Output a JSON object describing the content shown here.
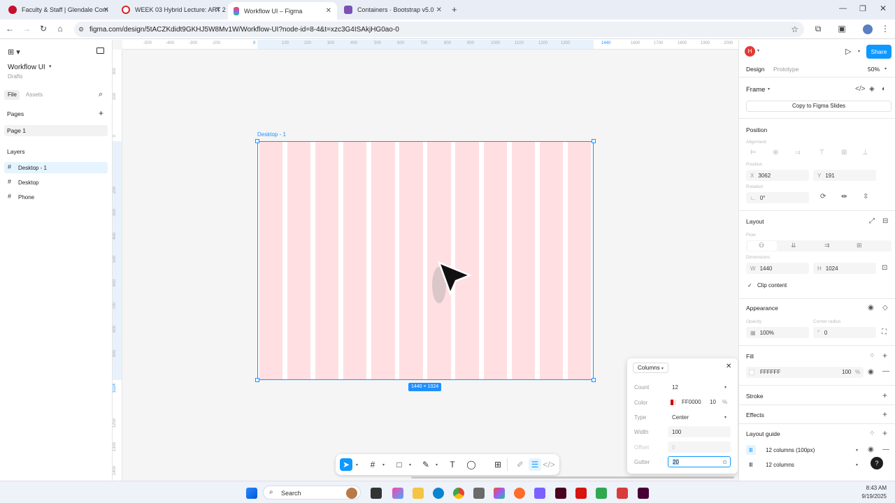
{
  "browser": {
    "tabs": [
      {
        "title": "Faculty & Staff | Glendale Com",
        "color": "#c8102e"
      },
      {
        "title": "WEEK 03 Hybrid Lecture: ART 2",
        "color": "#d22"
      },
      {
        "title": "Workflow UI – Figma",
        "color": "#a259ff"
      },
      {
        "title": "Containers · Bootstrap v5.0",
        "color": "#7952b3"
      }
    ],
    "url": "figma.com/design/5tACZKdidt9GKHJ5W8Mv1W/Workflow-UI?node-id=8-4&t=xzc3G4ISAkjHG0ao-0"
  },
  "left": {
    "file_name": "Workflow UI",
    "file_sub": "Drafts",
    "tab_file": "File",
    "tab_assets": "Assets",
    "pages_title": "Pages",
    "pages": [
      "Page 1"
    ],
    "layers_title": "Layers",
    "layers": [
      "Desktop - 1",
      "Desktop",
      "Phone"
    ]
  },
  "canvas": {
    "frame_label": "Desktop - 1",
    "frame_size": "1440 × 1024",
    "ruler_top": [
      "-500",
      "-400",
      "-300",
      "-200",
      "0",
      "100",
      "200",
      "300",
      "400",
      "500",
      "600",
      "700",
      "800",
      "900",
      "1000",
      "1100",
      "1200",
      "1300",
      "1440",
      "1600",
      "1700",
      "1800",
      "1900",
      "2000"
    ],
    "ruler_left": [
      "300",
      "200",
      "0",
      "200",
      "300",
      "400",
      "500",
      "600",
      "700",
      "800",
      "900",
      "1024",
      "1200",
      "1300",
      "1400"
    ]
  },
  "toolbar_icons": [
    "move-tool",
    "frame-tool",
    "shape-tool",
    "pen-tool",
    "text-tool",
    "comment-tool",
    "actions-tool",
    "draw-mode",
    "design-mode",
    "dev-mode"
  ],
  "columns_panel": {
    "title": "Columns",
    "count_label": "Count",
    "count": "12",
    "color_label": "Color",
    "color_hex": "FF0000",
    "color_opacity": "10",
    "color_pct": "%",
    "type_label": "Type",
    "type": "Center",
    "width_label": "Width",
    "width": "100",
    "offset_label": "Offset",
    "offset": "0",
    "gutter_label": "Gutter",
    "gutter": "20"
  },
  "right": {
    "avatar": "H",
    "share": "Share",
    "tab_design": "Design",
    "tab_prototype": "Prototype",
    "zoom": "50%",
    "frame_title": "Frame",
    "copy_slides": "Copy to Figma Slides",
    "position_title": "Position",
    "alignment_label": "Alignment",
    "position_label": "Position",
    "x_label": "X",
    "x": "3062",
    "y_label": "Y",
    "y": "191",
    "rotation_label": "Rotation",
    "rotation": "0°",
    "layout_title": "Layout",
    "flow_label": "Flow",
    "dimensions_label": "Dimensions",
    "w_label": "W",
    "w": "1440",
    "h_label": "H",
    "h": "1024",
    "clip": "Clip content",
    "appearance_title": "Appearance",
    "opacity_label": "Opacity",
    "opacity": "100%",
    "radius_label": "Corner radius",
    "radius": "0",
    "fill_title": "Fill",
    "fill_hex": "FFFFFF",
    "fill_opacity": "100",
    "fill_pct": "%",
    "stroke_title": "Stroke",
    "effects_title": "Effects",
    "layout_guide_title": "Layout guide",
    "guide1": "12 columns (100px)",
    "guide2": "12 columns"
  },
  "taskbar": {
    "search": "Search",
    "time": "8:43 AM",
    "date": "9/19/2025"
  },
  "colors": {
    "accent": "#0d99ff",
    "column_fill": "#ffdfe2",
    "frame_border": "#1e90ff"
  }
}
